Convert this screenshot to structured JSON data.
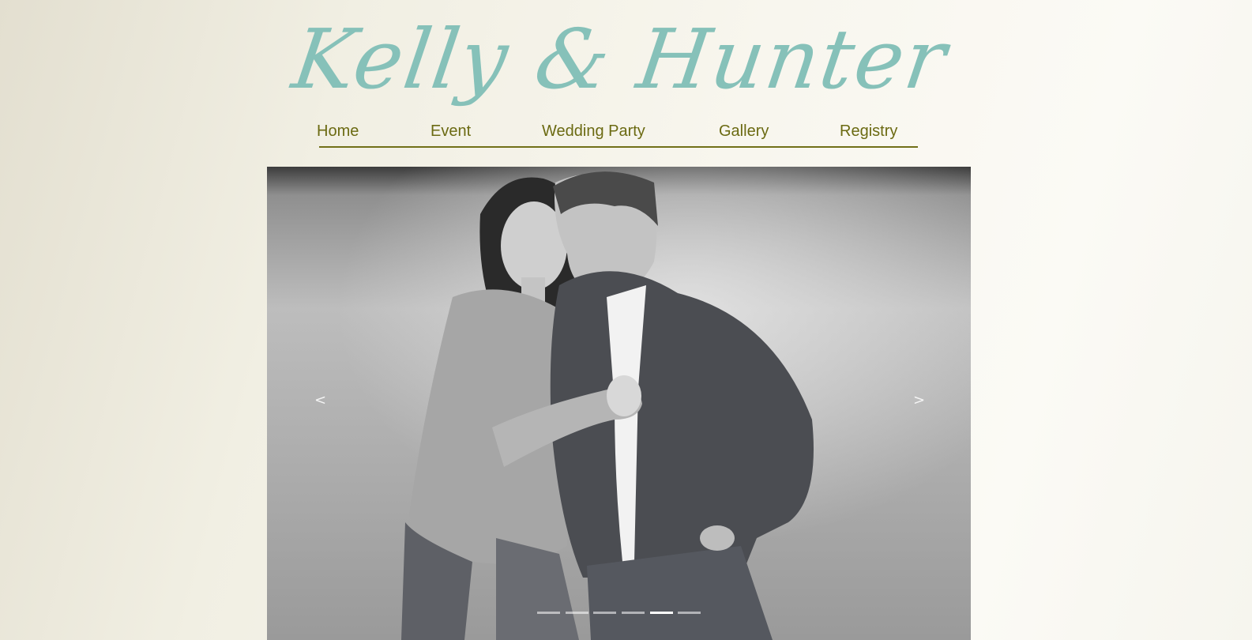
{
  "site": {
    "title": "Kelly & Hunter"
  },
  "nav": {
    "items": [
      {
        "label": "Home"
      },
      {
        "label": "Event"
      },
      {
        "label": "Wedding Party"
      },
      {
        "label": "Gallery"
      },
      {
        "label": "Registry"
      }
    ]
  },
  "slideshow": {
    "prev_arrow": "<",
    "next_arrow": ">",
    "slide_count": 6,
    "active_slide": 5,
    "image_description_icon": "photo-couple"
  },
  "colors": {
    "title": "#86c1b9",
    "nav_text": "#6b6a12",
    "nav_rule": "#717018"
  }
}
